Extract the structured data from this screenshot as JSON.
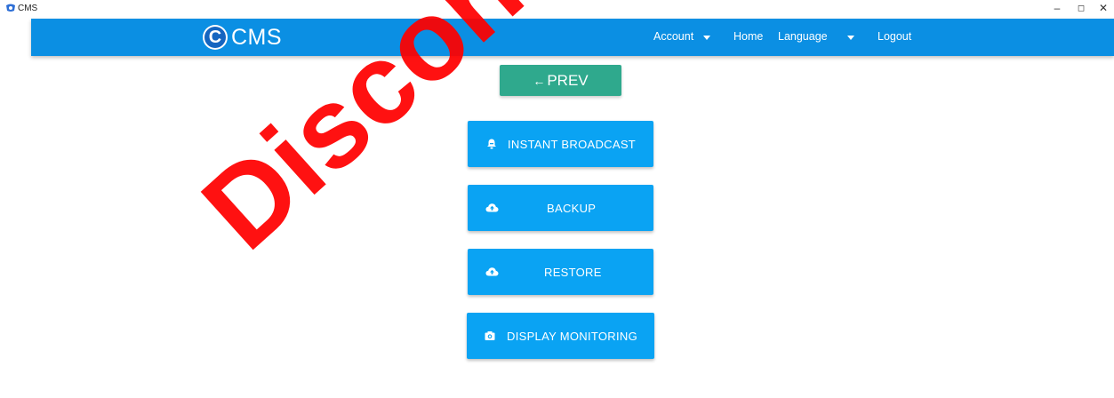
{
  "window": {
    "title": "CMS",
    "minimize_glyph": "–",
    "maximize_glyph": "◻",
    "close_glyph": "✕"
  },
  "navbar": {
    "brand_letter": "C",
    "brand_text": "CMS",
    "account_label": "Account",
    "home_label": "Home",
    "language_label": "Language",
    "logout_label": "Logout"
  },
  "actions": {
    "prev_arrow": "←",
    "prev_label": "PREV",
    "instant_broadcast_label": "INSTANT BROADCAST",
    "backup_label": "BACKUP",
    "restore_label": "RESTORE",
    "display_monitoring_label": "DISPLAY MONITORING"
  },
  "icons": {
    "instant_broadcast": "bell-icon",
    "backup": "cloud-upload-icon",
    "restore": "cloud-upload-icon",
    "display_monitoring": "camera-icon"
  },
  "watermark": "Discontinued",
  "colors": {
    "navbar": "#0b8fe3",
    "button": "#0aa3f3",
    "prev_button": "#2fa98d",
    "watermark": "#ff0000"
  }
}
